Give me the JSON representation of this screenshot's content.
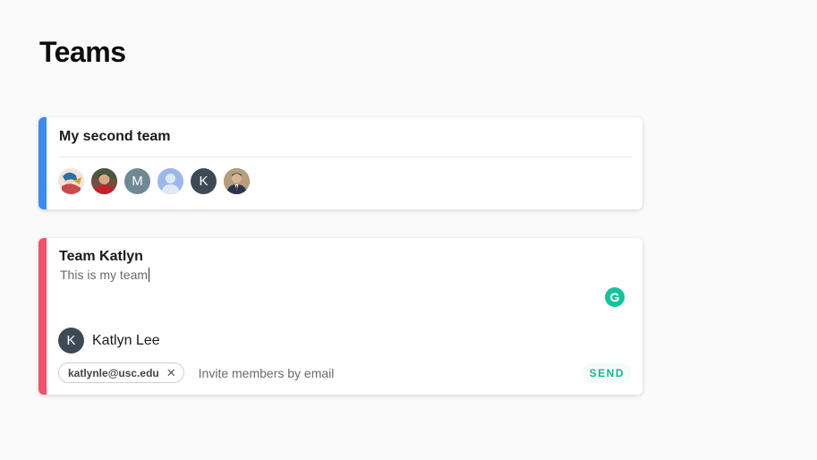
{
  "page": {
    "title": "Teams"
  },
  "colors": {
    "team1_stripe": "#3d8bf2",
    "team2_stripe": "#f6506b",
    "send": "#14b89a",
    "grammarly": "#15c39a"
  },
  "teams": [
    {
      "name": "My second team",
      "members": [
        {
          "type": "photo",
          "icon": "anime-character-photo",
          "bg": "#e6d6cc"
        },
        {
          "type": "photo",
          "icon": "man-red-shirt-photo",
          "bg": "#8a3d3a"
        },
        {
          "type": "initial",
          "initial": "M",
          "bg": "#6f8894"
        },
        {
          "type": "placeholder",
          "icon": "person-silhouette-icon",
          "bg": "#9cb7e8"
        },
        {
          "type": "initial",
          "initial": "K",
          "bg": "#3d4a56"
        },
        {
          "type": "photo",
          "icon": "man-suit-photo",
          "bg": "#5b5050"
        }
      ]
    },
    {
      "name": "Team Katlyn",
      "description": "This is my team",
      "member": {
        "initial": "K",
        "name": "Katlyn Lee"
      },
      "invite": {
        "chip_email": "katlynle@usc.edu",
        "placeholder": "Invite members by email",
        "send_label": "SEND"
      }
    }
  ]
}
